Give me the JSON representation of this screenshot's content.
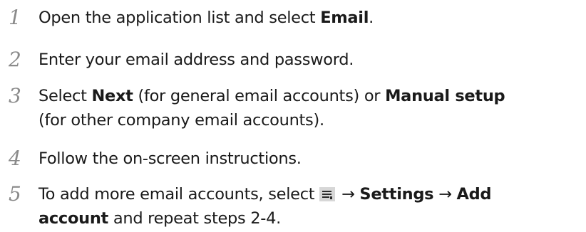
{
  "steps": [
    {
      "number": "1",
      "parts": [
        {
          "text": "Open the application list and select ",
          "bold": false
        },
        {
          "text": "Email",
          "bold": true
        },
        {
          "text": ".",
          "bold": false
        }
      ]
    },
    {
      "number": "2",
      "parts": [
        {
          "text": "Enter your email address and password.",
          "bold": false
        }
      ]
    },
    {
      "number": "3",
      "line1": [
        {
          "text": "Select ",
          "bold": false
        },
        {
          "text": "Next",
          "bold": true
        },
        {
          "text": " (for general email accounts) or ",
          "bold": false
        },
        {
          "text": "Manual setup",
          "bold": true
        }
      ],
      "line2": [
        {
          "text": "(for other company email accounts).",
          "bold": false
        }
      ]
    },
    {
      "number": "4",
      "parts": [
        {
          "text": "Follow the on-screen instructions.",
          "bold": false
        }
      ]
    },
    {
      "number": "5",
      "line1": [
        {
          "text": "To add more email accounts, select ",
          "bold": false
        },
        {
          "icon": "menu-icon"
        },
        {
          "text": " → ",
          "bold": false
        },
        {
          "text": "Settings",
          "bold": true
        },
        {
          "text": " → ",
          "bold": false
        },
        {
          "text": "Add",
          "bold": true
        }
      ],
      "line2": [
        {
          "text": "account",
          "bold": true
        },
        {
          "text": " and repeat steps 2-4.",
          "bold": false
        }
      ]
    }
  ]
}
